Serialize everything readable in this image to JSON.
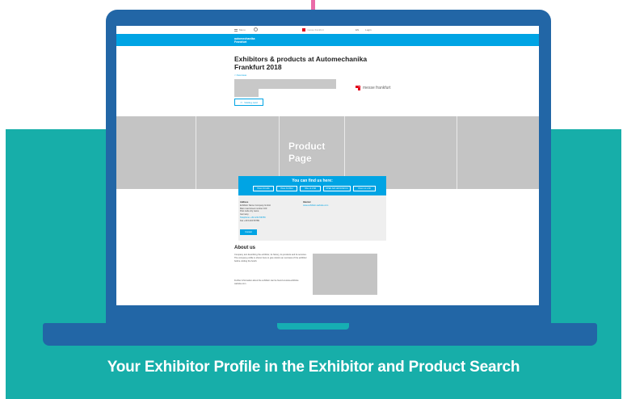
{
  "caption": "Your Exhibitor Profile in the Exhibitor and Product Search",
  "colors": {
    "teal": "#17aea9",
    "laptop_blue": "#2266a6",
    "site_blue": "#00a4e4",
    "placeholder_gray": "#c4c4c4",
    "accent_pink": "#ea6aa8"
  },
  "site": {
    "topbar": {
      "menu_label": "Menu",
      "search_icon": "search-icon",
      "logo_text": "messe frankfurt",
      "user_label": "EN",
      "login_label": "Login"
    },
    "bluebar": {
      "brand_line1": "automechanika",
      "brand_line2": "Frankfurt"
    },
    "page_title": "Exhibitors & products at Automechanika Frankfurt 2018",
    "back_link": "< Overview",
    "logo_text": "messe frankfurt",
    "visiting_card_button": "Visiting card",
    "product_page_label": "Product Page",
    "find_us": {
      "title": "You can find us here:",
      "halls": [
        "HALL 8.0 A01",
        "HALL 8.0 B12",
        "HALL 9.0 B3",
        "OPEN AIR GROUND 8.0",
        "HALL 12.1 A8"
      ]
    },
    "address": {
      "heading": "Address",
      "lines": [
        "Exhibitor Name Company GmbH",
        "Main road street number 100",
        "Post code city name",
        "Germany"
      ],
      "phone": "Telephone +49 1234 56789",
      "fax": "Fax +49 1234 56789",
      "contact_button": "Contact"
    },
    "internet": {
      "heading": "Internet",
      "link": "www.exhibitor-website.com"
    },
    "about": {
      "title": "About us",
      "text": "Company text describing the exhibitor, its history, its products and its services. The company profile is shown here to give visitors an overview of the exhibitor before visiting the booth.",
      "more": "Further information about the exhibitor can be found at www.exhibitor-website.com"
    }
  }
}
